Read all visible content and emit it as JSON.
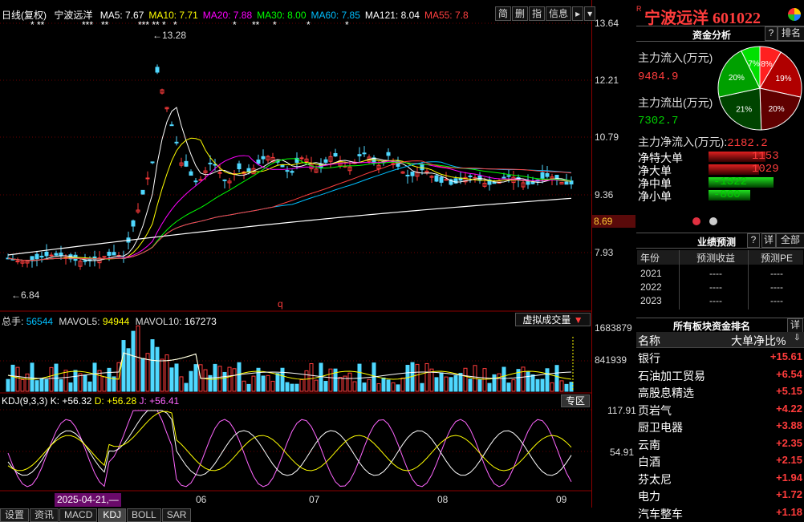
{
  "chart": {
    "period": "日线(复权)",
    "stock_name": "宁波远洋",
    "ma": [
      {
        "label": "MA5: 7.67",
        "color": "#ffffff"
      },
      {
        "label": "MA10: 7.71",
        "color": "#ffff00"
      },
      {
        "label": "MA20: 7.88",
        "color": "#ff00ff"
      },
      {
        "label": "MA30: 8.00",
        "color": "#00ff00"
      },
      {
        "label": "MA60: 7.85",
        "color": "#00bfff"
      },
      {
        "label": "MA121: 8.04",
        "color": "#ffffff"
      },
      {
        "label": "MA55: 7.8",
        "color": "#ff4040"
      }
    ],
    "tools": [
      "简",
      "删",
      "指",
      "信息"
    ],
    "price_axis": [
      "13.64",
      "12.21",
      "10.79",
      "9.36",
      "7.93"
    ],
    "current_price": "8.69",
    "high_marker": "13.28",
    "low_marker": "6.84",
    "q_marker": "q",
    "stars": [
      "* **",
      "***   **",
      "*** ** *",
      "*",
      "*",
      "**",
      "*",
      "*",
      "*"
    ],
    "volume": {
      "label_total": "总手:",
      "total": "56544",
      "mavol5_label": "MAVOL5:",
      "mavol5": "94944",
      "mavol10_label": "MAVOL10:",
      "mavol10": "167273",
      "axis": [
        "1683879",
        "841939"
      ],
      "virtual_btn": "虚拟成交量"
    },
    "kdj": {
      "label": "KDJ(9,3,3)",
      "k": "K: +56.32",
      "d": "D: +56.28",
      "j": "J: +56.41",
      "axis": [
        "117.91",
        "54.91"
      ],
      "zone_btn": "专区"
    },
    "date_cursor": "2025-04-21,—",
    "months": [
      "06",
      "07",
      "08",
      "09"
    ],
    "bottom_tabs": [
      "设置",
      "资讯",
      "MACD",
      "KDJ",
      "BOLL",
      "SAR"
    ],
    "active_tab": "KDJ"
  },
  "right": {
    "title": "宁波远洋 601022",
    "fund_tab": "资金分析",
    "rank_tab": "排名",
    "help": "?",
    "inflow_label": "主力流入(万元)",
    "inflow_value": "9484.9",
    "outflow_label": "主力流出(万元)",
    "outflow_value": "7302.7",
    "net_label": "主力净流入(万元):",
    "net_value": "2182.2",
    "pie": [
      {
        "label": "8%",
        "value": 8,
        "color": "#ff2020"
      },
      {
        "label": "19%",
        "value": 19,
        "color": "#b00000"
      },
      {
        "label": "20%",
        "value": 20,
        "color": "#600000"
      },
      {
        "label": "21%",
        "value": 21,
        "color": "#004400"
      },
      {
        "label": "20%",
        "value": 20,
        "color": "#00a000"
      },
      {
        "label": "7%",
        "value": 7,
        "color": "#00e000"
      }
    ],
    "flows": [
      {
        "label": "净特大单",
        "value": "1153",
        "frac": 0.62,
        "color": "#e02020"
      },
      {
        "label": "净大单",
        "value": "1029",
        "frac": 0.55,
        "color": "#e02020"
      },
      {
        "label": "净中单",
        "value": "-1322",
        "frac": 0.71,
        "color": "#10c010"
      },
      {
        "label": "净小单",
        "value": "-860",
        "frac": 0.46,
        "color": "#10c010"
      }
    ],
    "forecast": {
      "title": "业绩预测",
      "help": "?",
      "detail": "详",
      "all": "全部",
      "headers": [
        "年份",
        "预测收益",
        "预测PE"
      ],
      "rows": [
        [
          "2021",
          "----",
          "----"
        ],
        [
          "2022",
          "----",
          "----"
        ],
        [
          "2023",
          "----",
          "----"
        ]
      ]
    },
    "sector": {
      "title": "所有板块资金排名",
      "detail": "详",
      "col_name": "名称",
      "col_value": "大单净比%",
      "rows": [
        [
          "银行",
          "+15.61"
        ],
        [
          "石油加工贸易",
          "+6.54"
        ],
        [
          "高股息精选",
          "+5.15"
        ],
        [
          "页岩气",
          "+4.22"
        ],
        [
          "厨卫电器",
          "+3.88"
        ],
        [
          "云南",
          "+2.35"
        ],
        [
          "白酒",
          "+2.15"
        ],
        [
          "芬太尼",
          "+1.94"
        ],
        [
          "电力",
          "+1.72"
        ],
        [
          "汽车整车",
          "+1.18"
        ]
      ]
    }
  }
}
